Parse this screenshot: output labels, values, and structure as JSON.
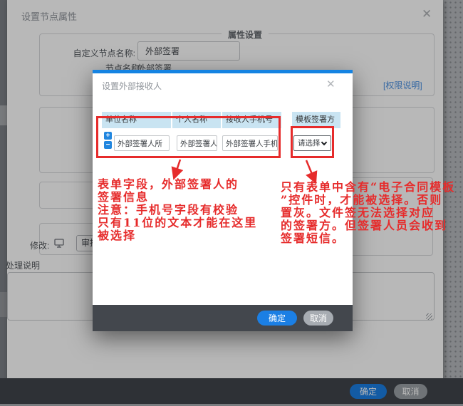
{
  "outer_dialog": {
    "title": "设置节点属性",
    "close_icon": "✕",
    "fieldset_legend": "属性设置",
    "custom_node_name_label": "自定义节点名称:",
    "custom_node_name_value": "外部签署",
    "node_name_label": "节点名称:",
    "node_name_value": "外部签署",
    "permission_link": "[权限说明]",
    "modify_label": "修改:",
    "approve_select_value": "审批",
    "process_note_label": "处理说明",
    "footer": {
      "ok_label": "确定",
      "cancel_label": "取消"
    }
  },
  "modal": {
    "title": "设置外部接收人",
    "close_icon": "✕",
    "table": {
      "headers": [
        "单位名称",
        "个人名称",
        "接收人手机号",
        "模板签署方"
      ],
      "row": {
        "add_button": "+",
        "remove_button": "−",
        "unit_value": "外部签署人所",
        "person_value": "外部签署人姓",
        "phone_value": "外部签署人手机",
        "signer_select_value": "请选择"
      }
    },
    "footer": {
      "ok_label": "确定",
      "cancel_label": "取消"
    }
  },
  "annotations": {
    "left_note_lines": [
      "表单字段，外部签署人的",
      "签署信息",
      "注意：手机号字段有校验",
      "只有11位的文本才能在这里",
      "被选择"
    ],
    "right_note_lines": [
      "只有表单中含有“电子合同模板",
      "”控件时，才能被选择。否则",
      "置灰。文件签无法选择对应",
      "的签署方。但签署人员会收到",
      "签署短信。"
    ]
  },
  "colors": {
    "accent_blue": "#1b7fe4",
    "modal_topbar_blue": "#1583e2",
    "table_header_blue": "#c9e4f2",
    "annotation_red": "#e62b2b",
    "footer_dark": "#43474d",
    "link_blue": "#4a90e2"
  }
}
